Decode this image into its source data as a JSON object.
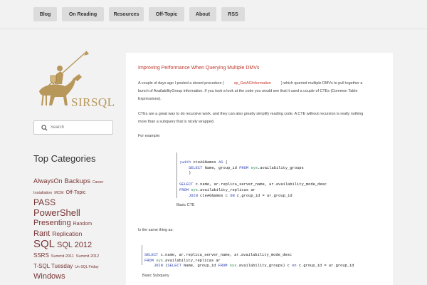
{
  "nav": [
    {
      "label": "Blog"
    },
    {
      "label": "On Reading"
    },
    {
      "label": "Resources"
    },
    {
      "label": "Off-Topic"
    },
    {
      "label": "About"
    },
    {
      "label": "RSS"
    }
  ],
  "brand": {
    "name": "SIRSQL"
  },
  "search": {
    "placeholder": "Search"
  },
  "sidebar": {
    "title": "Top Categories",
    "tags": [
      {
        "label": "AlwaysOn"
      },
      {
        "label": "Backups"
      },
      {
        "label": "Career"
      },
      {
        "label": "Installation"
      },
      {
        "label": "MCM"
      },
      {
        "label": "Off-Topic"
      },
      {
        "label": "PASS"
      },
      {
        "label": "PowerShell"
      },
      {
        "label": "Presenting"
      },
      {
        "label": "Random"
      },
      {
        "label": "Rant"
      },
      {
        "label": "Replication"
      },
      {
        "label": "SQL"
      },
      {
        "label": "SQL 2012"
      },
      {
        "label": "SSRS"
      },
      {
        "label": "Summit 2011"
      },
      {
        "label": "Summit 2012"
      },
      {
        "label": "T-SQL Tuesday"
      },
      {
        "label": "Un-SQL Friday"
      },
      {
        "label": "Windows"
      }
    ]
  },
  "post": {
    "title": "Improving Performance When Querying Multiple DMVs",
    "para1_a": "A couple of days ago I posted a stored procedure (",
    "para1_link": "sp_GetAGInformation",
    "para1_b": ") which queried multiple DMVs to pull together a bunch of AvailabilityGroup information. If you took a look at the code you would see that it used a couple of CTEs (Common Table Expressions).",
    "para2": "CTEs are a great way to do recursive work, and they can also greatly simplify reading code. A CTE without recursion is really nothing more than a subquery that is nicely wrapped.",
    "for_example": "For example:",
    "code1": [
      ";with cteAGNames AS (",
      "    SELECT Name, group_id FROM sys.availability_groups",
      "    )",
      "SELECT c.name, ar.replica_server_name, ar.availability_mode_desc",
      "FROM sys.availability_replicas ar",
      "    JOIN cteAGNames c ON c.group_id = ar.group_id"
    ],
    "caption1": "Basic CTE",
    "same_as": "Is the same thing as:",
    "code2": [
      "SELECT c.name, ar.replica_server_name, ar.availability_mode_desc",
      "FROM sys.availability_replicas ar",
      "    JOIN (SELECT Name, group_id FROM sys.availability_groups) c on c.group_id = ar.group_id"
    ],
    "caption2": "Basic Subquery"
  }
}
